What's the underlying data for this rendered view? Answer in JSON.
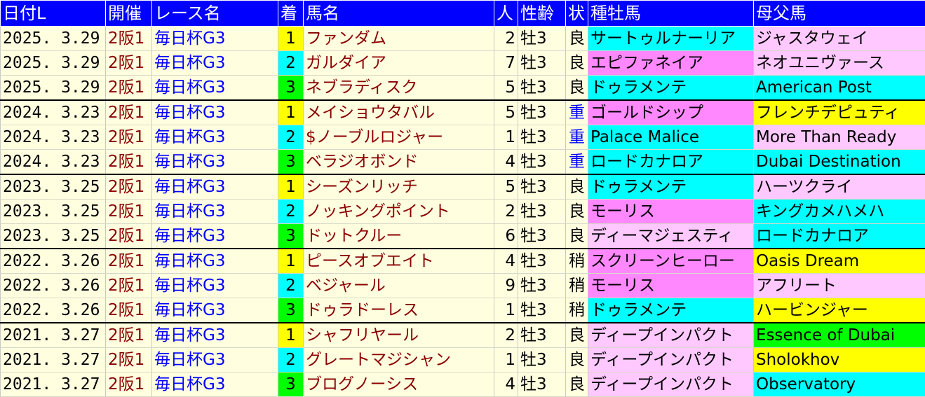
{
  "headers": [
    "日付L",
    "開催",
    "レース名",
    "着",
    "馬名",
    "人",
    "性齢",
    "状",
    "種牡馬",
    "母父馬"
  ],
  "colors": {
    "header_bg": "#0000ff",
    "row_bg": "#ffffe0",
    "place_1": "#ffff00",
    "place_2": "#00ffff",
    "place_3": "#00ff00",
    "track_heavy": "#0000ff",
    "cell_pink": "#ff88ff",
    "cell_lightpink": "#ffc8ff",
    "cell_cyan": "#00ffff",
    "cell_yellow": "#ffff00",
    "cell_green": "#00ff00"
  },
  "rows": [
    {
      "date": "2025. 3.29",
      "kaisai": "2阪1",
      "race": "毎日杯G3",
      "place": "1",
      "horse": "ファンダム",
      "pop": "2",
      "sexage": "牡3",
      "track": "良",
      "sire": "サートゥルナーリア",
      "sire_color": "cyan",
      "dam_sire": "ジャスタウェイ",
      "dam_color": "lightpink"
    },
    {
      "date": "2025. 3.29",
      "kaisai": "2阪1",
      "race": "毎日杯G3",
      "place": "2",
      "horse": "ガルダイア",
      "pop": "7",
      "sexage": "牡3",
      "track": "良",
      "sire": "エピファネイア",
      "sire_color": "pink",
      "dam_sire": "ネオユニヴァース",
      "dam_color": "lightpink"
    },
    {
      "date": "2025. 3.29",
      "kaisai": "2阪1",
      "race": "毎日杯G3",
      "place": "3",
      "horse": "ネブラディスク",
      "pop": "5",
      "sexage": "牡3",
      "track": "良",
      "sire": "ドゥラメンテ",
      "sire_color": "cyan",
      "dam_sire": "American Post",
      "dam_color": "cyan"
    },
    {
      "date": "2024. 3.23",
      "kaisai": "2阪1",
      "race": "毎日杯G3",
      "place": "1",
      "horse": "メイショウタバル",
      "pop": "5",
      "sexage": "牡3",
      "track": "重",
      "sire": "ゴールドシップ",
      "sire_color": "pink",
      "dam_sire": "フレンチデピュティ",
      "dam_color": "yellow"
    },
    {
      "date": "2024. 3.23",
      "kaisai": "2阪1",
      "race": "毎日杯G3",
      "place": "2",
      "horse": "$ノーブルロジャー",
      "pop": "1",
      "sexage": "牡3",
      "track": "重",
      "sire": "Palace Malice",
      "sire_color": "cyan",
      "dam_sire": "More Than Ready",
      "dam_color": "lightpink"
    },
    {
      "date": "2024. 3.23",
      "kaisai": "2阪1",
      "race": "毎日杯G3",
      "place": "3",
      "horse": "ベラジオボンド",
      "pop": "4",
      "sexage": "牡3",
      "track": "重",
      "sire": "ロードカナロア",
      "sire_color": "cyan",
      "dam_sire": "Dubai Destination",
      "dam_color": "cyan"
    },
    {
      "date": "2023. 3.25",
      "kaisai": "2阪1",
      "race": "毎日杯G3",
      "place": "1",
      "horse": "シーズンリッチ",
      "pop": "5",
      "sexage": "牡3",
      "track": "良",
      "sire": "ドゥラメンテ",
      "sire_color": "cyan",
      "dam_sire": "ハーツクライ",
      "dam_color": "lightpink"
    },
    {
      "date": "2023. 3.25",
      "kaisai": "2阪1",
      "race": "毎日杯G3",
      "place": "2",
      "horse": "ノッキングポイント",
      "pop": "2",
      "sexage": "牡3",
      "track": "良",
      "sire": "モーリス",
      "sire_color": "pink",
      "dam_sire": "キングカメハメハ",
      "dam_color": "cyan"
    },
    {
      "date": "2023. 3.25",
      "kaisai": "2阪1",
      "race": "毎日杯G3",
      "place": "3",
      "horse": "ドットクルー",
      "pop": "6",
      "sexage": "牡3",
      "track": "良",
      "sire": "ディーマジェスティ",
      "sire_color": "lightpink",
      "dam_sire": "ロードカナロア",
      "dam_color": "cyan"
    },
    {
      "date": "2022. 3.26",
      "kaisai": "2阪1",
      "race": "毎日杯G3",
      "place": "1",
      "horse": "ピースオブエイト",
      "pop": "4",
      "sexage": "牡3",
      "track": "稍",
      "sire": "スクリーンヒーロー",
      "sire_color": "pink",
      "dam_sire": "Oasis Dream",
      "dam_color": "yellow"
    },
    {
      "date": "2022. 3.26",
      "kaisai": "2阪1",
      "race": "毎日杯G3",
      "place": "2",
      "horse": "ベジャール",
      "pop": "9",
      "sexage": "牡3",
      "track": "稍",
      "sire": "モーリス",
      "sire_color": "pink",
      "dam_sire": "アフリート",
      "dam_color": "lightpink"
    },
    {
      "date": "2022. 3.26",
      "kaisai": "2阪1",
      "race": "毎日杯G3",
      "place": "3",
      "horse": "ドゥラドーレス",
      "pop": "1",
      "sexage": "牡3",
      "track": "稍",
      "sire": "ドゥラメンテ",
      "sire_color": "cyan",
      "dam_sire": "ハービンジャー",
      "dam_color": "yellow"
    },
    {
      "date": "2021. 3.27",
      "kaisai": "2阪1",
      "race": "毎日杯G3",
      "place": "1",
      "horse": "シャフリヤール",
      "pop": "2",
      "sexage": "牡3",
      "track": "良",
      "sire": "ディープインパクト",
      "sire_color": "lightpink",
      "dam_sire": "Essence of Dubai",
      "dam_color": "green"
    },
    {
      "date": "2021. 3.27",
      "kaisai": "2阪1",
      "race": "毎日杯G3",
      "place": "2",
      "horse": "グレートマジシャン",
      "pop": "1",
      "sexage": "牡3",
      "track": "良",
      "sire": "ディープインパクト",
      "sire_color": "lightpink",
      "dam_sire": "Sholokhov",
      "dam_color": "yellow"
    },
    {
      "date": "2021. 3.27",
      "kaisai": "2阪1",
      "race": "毎日杯G3",
      "place": "3",
      "horse": "ブログノーシス",
      "pop": "4",
      "sexage": "牡3",
      "track": "良",
      "sire": "ディープインパクト",
      "sire_color": "lightpink",
      "dam_sire": "Observatory",
      "dam_color": "cyan"
    }
  ]
}
